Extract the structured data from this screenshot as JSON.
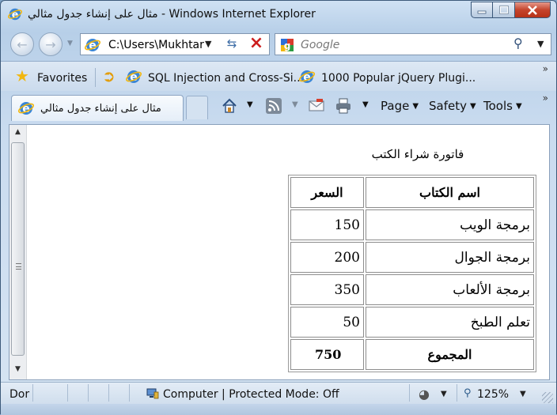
{
  "window": {
    "title": "مثال على إنشاء جدول مثالي - Windows Internet Explorer",
    "minimize_icon": "minimize-icon",
    "maximize_icon": "maximize-icon",
    "close_icon": "close-icon"
  },
  "navigation": {
    "back_icon": "back-arrow-icon",
    "forward_icon": "forward-arrow-icon",
    "address": "C:\\Users\\Mukhtar",
    "refresh_icon": "refresh-icon",
    "stop_icon": "stop-icon"
  },
  "search": {
    "placeholder": "Google",
    "search_icon": "magnifier-icon"
  },
  "favorites": {
    "label": "Favorites",
    "links": [
      {
        "label": "SQL Injection and Cross-Si..."
      },
      {
        "label": "1000 Popular jQuery Plugi..."
      }
    ]
  },
  "tab": {
    "label": "مثال على إنشاء جدول مثالي"
  },
  "commandbar": {
    "page": "Page",
    "safety": "Safety",
    "tools": "Tools"
  },
  "content": {
    "caption": "فاتورة شراء الكتب",
    "table": {
      "headers": {
        "name": "اسم الكتاب",
        "price": "السعر"
      },
      "rows": [
        {
          "name": "برمجة الويب",
          "price": "150"
        },
        {
          "name": "برمجة الجوال",
          "price": "200"
        },
        {
          "name": "برمجة الألعاب",
          "price": "350"
        },
        {
          "name": "تعلم الطبخ",
          "price": "50"
        }
      ],
      "total": {
        "label": "المجموع",
        "value": "750"
      }
    }
  },
  "status": {
    "text": "Dor",
    "zone": "Computer | Protected Mode: Off",
    "zoom": "125%"
  },
  "colors": {
    "titlebar": "#b7cfe8",
    "close_button": "#c5442c",
    "link_star": "#f1b710"
  }
}
